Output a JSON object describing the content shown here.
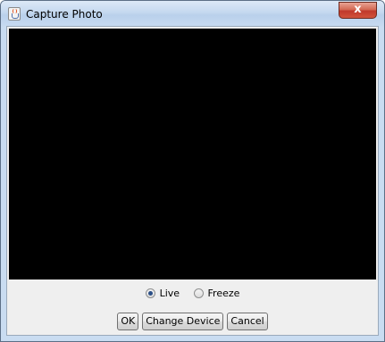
{
  "window": {
    "title": "Capture Photo",
    "close_symbol": "x"
  },
  "icons": {
    "app": "java-cup-icon",
    "close": "close-icon"
  },
  "preview": {
    "background": "#000000"
  },
  "mode": {
    "options": [
      {
        "label": "Live",
        "selected": true
      },
      {
        "label": "Freeze",
        "selected": false
      }
    ]
  },
  "buttons": {
    "ok": "OK",
    "change_device": "Change Device",
    "cancel": "Cancel"
  }
}
